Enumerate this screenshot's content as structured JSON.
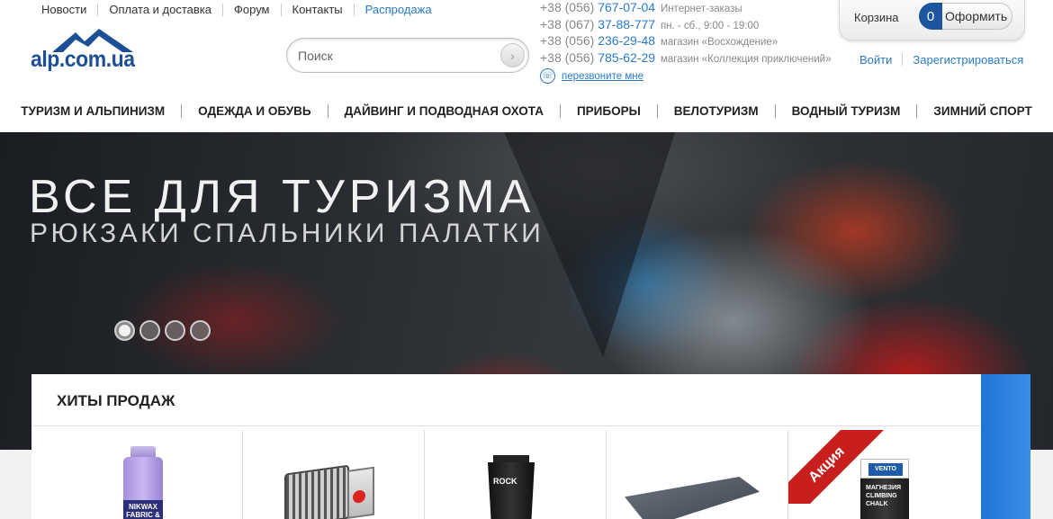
{
  "top_links": [
    "Новости",
    "Оплата и доставка",
    "Форум",
    "Контакты",
    "Распродажа"
  ],
  "logo_text": "alp.com.ua",
  "search": {
    "placeholder": "Поиск"
  },
  "phones": [
    {
      "code": "+38 (056)",
      "number": "767-07-04",
      "note": "Интернет-заказы"
    },
    {
      "code": "+38 (067)",
      "number": "37-88-777",
      "note": "пн. - сб., 9:00 - 19:00"
    },
    {
      "code": "+38 (056)",
      "number": "236-29-48",
      "note": "магазин «Восхождение»"
    },
    {
      "code": "+38 (056)",
      "number": "785-62-29",
      "note": "магазин «Коллекция приключений»"
    }
  ],
  "callback_label": "перезвоните мне",
  "cart": {
    "label": "Корзина",
    "count": "0",
    "order_label": "Оформить"
  },
  "auth": {
    "login": "Войти",
    "register": "Зарегистрироваться"
  },
  "nav": [
    "ТУРИЗМ И АЛЬПИНИЗМ",
    "ОДЕЖДА И ОБУВЬ",
    "ДАЙВИНГ И ПОДВОДНАЯ ОХОТА",
    "ПРИБОРЫ",
    "ВЕЛОТУРИЗМ",
    "ВОДНЫЙ ТУРИЗМ",
    "ЗИМНИЙ СПОРТ"
  ],
  "hero": {
    "headline": "ВСЕ ДЛЯ ТУРИЗМА",
    "subline": "РЮКЗАКИ СПАЛЬНИКИ ПАЛАТКИ",
    "slides_total": 4,
    "active_slide": 1
  },
  "hits": {
    "title": "ХИТЫ ПРОДАЖ",
    "products": [
      {
        "label_text": "NIKWAX FABRIC &"
      },
      {
        "label_text": ""
      },
      {
        "label_text": "ROCK"
      },
      {
        "label_text": ""
      },
      {
        "badge": "Акция",
        "brand": "VENTO",
        "label_text": "МАГНЕЗИЯ CLIMBING CHALK"
      }
    ]
  },
  "colors": {
    "link": "#2a7ac8",
    "brand": "#1c4f96",
    "cart_count": "#1d56a0",
    "sale_badge": "#c81e1e",
    "side_accent": "#1f74d6"
  }
}
